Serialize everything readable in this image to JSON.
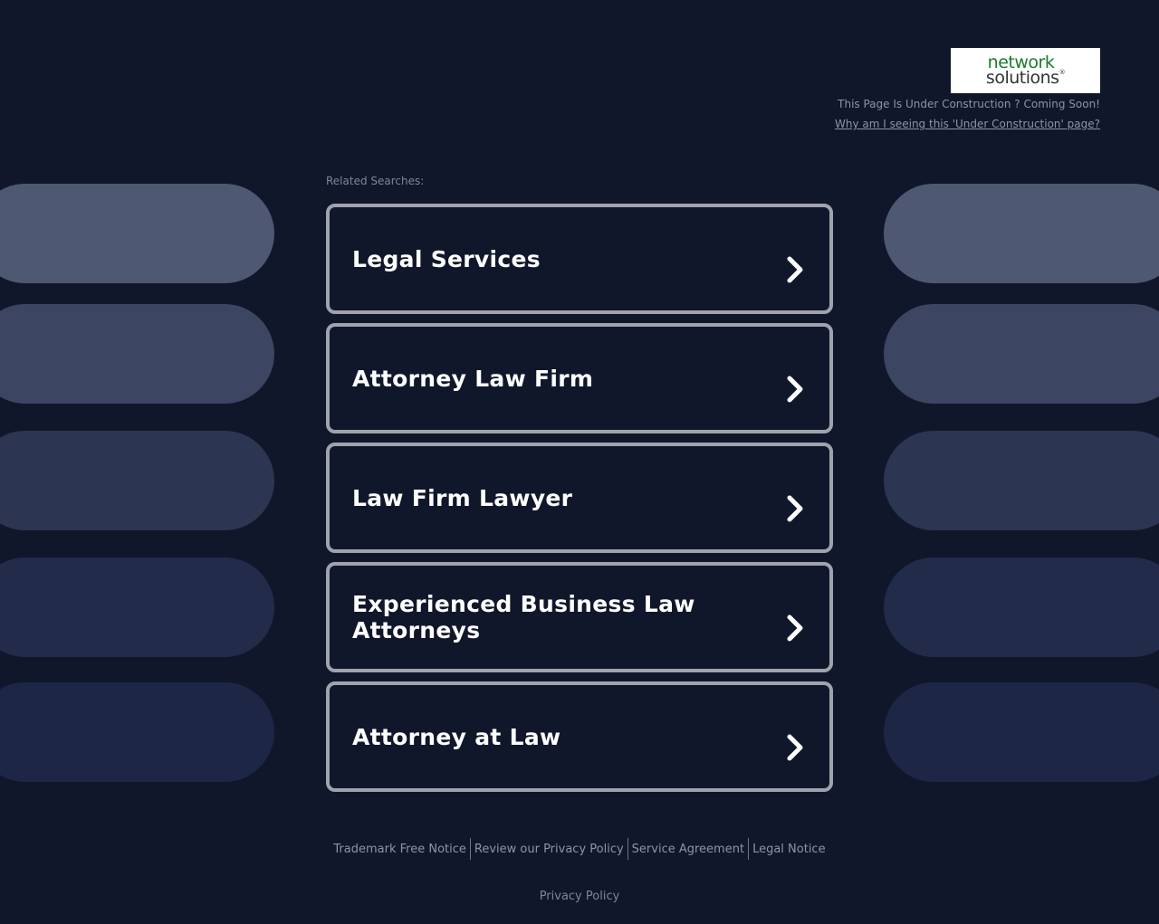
{
  "logo": {
    "line1": "network",
    "line2": "solutions",
    "mark": "®"
  },
  "header": {
    "status_text": "This Page Is Under Construction ? Coming Soon!",
    "why_link": "Why am I seeing this 'Under Construction' page?"
  },
  "related_label": "Related Searches:",
  "searches": [
    {
      "label": "Legal Services"
    },
    {
      "label": "Attorney Law Firm"
    },
    {
      "label": "Law Firm Lawyer"
    },
    {
      "label": "Experienced Business Law Attorneys"
    },
    {
      "label": "Attorney at Law"
    }
  ],
  "footer": {
    "links": [
      "Trademark Free Notice",
      "Review our Privacy Policy",
      "Service Agreement",
      "Legal Notice"
    ],
    "privacy": "Privacy Policy"
  },
  "colors": {
    "background": "#11172b",
    "card_border": "#a0a3ad",
    "logo_green": "#1a7a2e"
  },
  "icons": {
    "card_arrow": "chevron-right-icon"
  }
}
